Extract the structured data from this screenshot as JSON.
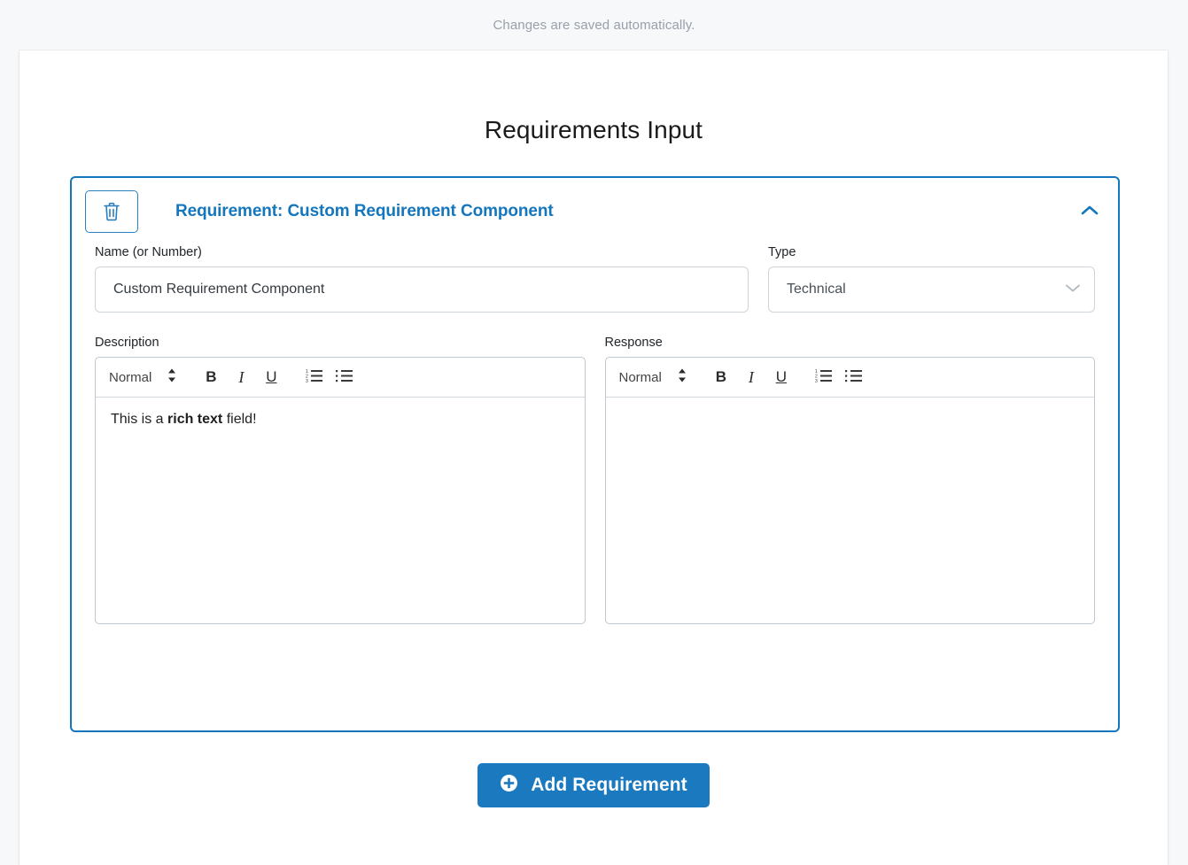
{
  "autosave": {
    "message": "Changes are saved automatically."
  },
  "page": {
    "title": "Requirements Input"
  },
  "colors": {
    "accent_blue": "#1476bc",
    "button_blue": "#1a79bf",
    "border_gray": "#ced4da",
    "muted_text": "#9aa0ab",
    "page_bg": "#f6f8fa"
  },
  "requirement_card": {
    "header": {
      "title": "Requirement: Custom Requirement Component",
      "delete_icon": "trash-icon",
      "collapse_icon": "chevron-up-icon",
      "expanded": true
    },
    "fields": {
      "name": {
        "label": "Name (or Number)",
        "value": "Custom Requirement Component",
        "placeholder": ""
      },
      "type": {
        "label": "Type",
        "value": "Technical",
        "caret_icon": "chevron-down-icon",
        "options": [
          "Technical"
        ]
      },
      "description": {
        "label": "Description",
        "toolbar": {
          "format_label": "Normal",
          "format_caret_icon": "updown-caret-icon",
          "bold_label": "B",
          "italic_label": "I",
          "underline_label": "U",
          "ordered_list_icon": "ordered-list-icon",
          "bullet_list_icon": "bullet-list-icon"
        },
        "content_prefix": "This is a ",
        "content_bold": "rich text",
        "content_suffix": " field!"
      },
      "response": {
        "label": "Response",
        "toolbar": {
          "format_label": "Normal",
          "format_caret_icon": "updown-caret-icon",
          "bold_label": "B",
          "italic_label": "I",
          "underline_label": "U",
          "ordered_list_icon": "ordered-list-icon",
          "bullet_list_icon": "bullet-list-icon"
        },
        "content": ""
      }
    }
  },
  "actions": {
    "add_requirement_label": "Add Requirement",
    "add_requirement_icon": "plus-circle-icon"
  }
}
